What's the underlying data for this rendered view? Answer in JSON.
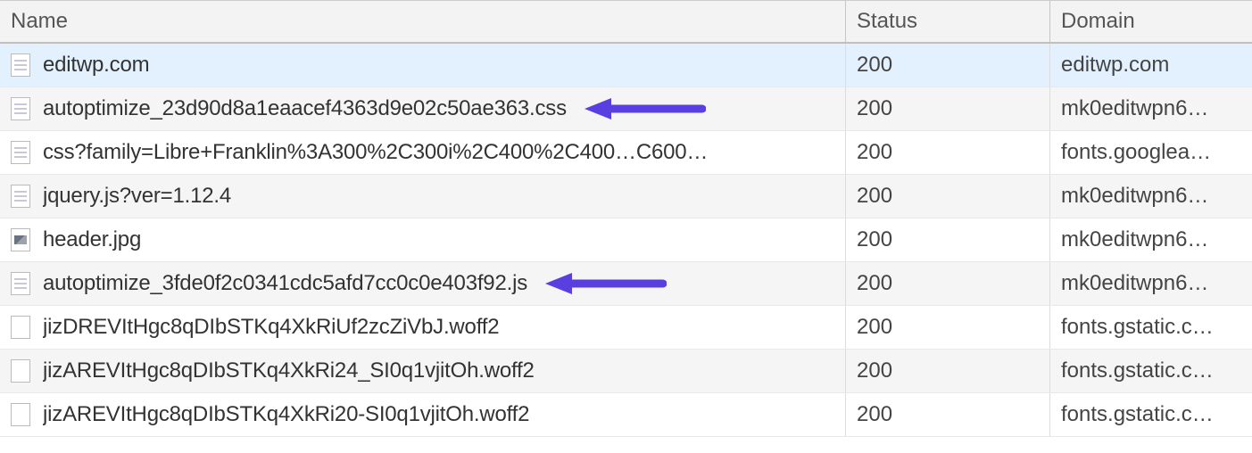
{
  "columns": {
    "name": "Name",
    "status": "Status",
    "domain": "Domain"
  },
  "annotation_color": "#5a3fe0",
  "rows": [
    {
      "icon": "doc",
      "name": "editwp.com",
      "status": "200",
      "domain": "editwp.com",
      "selected": true,
      "arrow": false
    },
    {
      "icon": "doc",
      "name": "autoptimize_23d90d8a1eaacef4363d9e02c50ae363.css",
      "status": "200",
      "domain": "mk0editwpn6…",
      "selected": false,
      "arrow": true
    },
    {
      "icon": "doc",
      "name": "css?family=Libre+Franklin%3A300%2C300i%2C400%2C400…C600…",
      "status": "200",
      "domain": "fonts.googlea…",
      "selected": false,
      "arrow": false
    },
    {
      "icon": "doc",
      "name": "jquery.js?ver=1.12.4",
      "status": "200",
      "domain": "mk0editwpn6…",
      "selected": false,
      "arrow": false
    },
    {
      "icon": "image",
      "name": "header.jpg",
      "status": "200",
      "domain": "mk0editwpn6…",
      "selected": false,
      "arrow": false
    },
    {
      "icon": "doc",
      "name": "autoptimize_3fde0f2c0341cdc5afd7cc0c0e403f92.js",
      "status": "200",
      "domain": "mk0editwpn6…",
      "selected": false,
      "arrow": true
    },
    {
      "icon": "font",
      "name": "jizDREVItHgc8qDIbSTKq4XkRiUf2zcZiVbJ.woff2",
      "status": "200",
      "domain": "fonts.gstatic.c…",
      "selected": false,
      "arrow": false
    },
    {
      "icon": "font",
      "name": "jizAREVItHgc8qDIbSTKq4XkRi24_SI0q1vjitOh.woff2",
      "status": "200",
      "domain": "fonts.gstatic.c…",
      "selected": false,
      "arrow": false
    },
    {
      "icon": "font",
      "name": "jizAREVItHgc8qDIbSTKq4XkRi20-SI0q1vjitOh.woff2",
      "status": "200",
      "domain": "fonts.gstatic.c…",
      "selected": false,
      "arrow": false
    }
  ]
}
